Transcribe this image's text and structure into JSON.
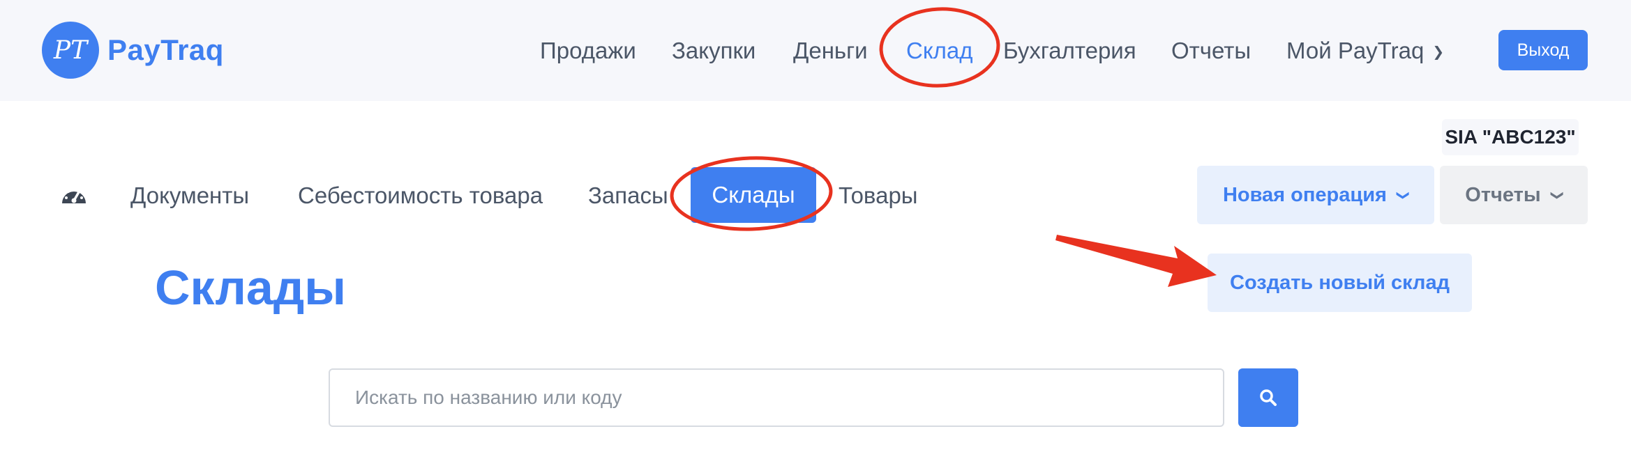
{
  "brand": {
    "logo_monogram": "PT",
    "name": "PayTraq"
  },
  "top_nav": {
    "items": [
      {
        "label": "Продажи"
      },
      {
        "label": "Закупки"
      },
      {
        "label": "Деньги"
      },
      {
        "label": "Склад",
        "active": true
      },
      {
        "label": "Бухгалтерия"
      },
      {
        "label": "Отчеты"
      },
      {
        "label": "Мой PayTraq",
        "has_dropdown": true
      }
    ],
    "logout_label": "Выход"
  },
  "company": "SIA \"ABC123\"",
  "sub_nav": {
    "dashboard_icon": "speedometer-icon",
    "items": [
      {
        "label": "Документы"
      },
      {
        "label": "Себестоимость товара"
      },
      {
        "label": "Запасы"
      },
      {
        "label": "Склады",
        "active": true
      },
      {
        "label": "Товары"
      }
    ],
    "new_operation_label": "Новая операция",
    "reports_label": "Отчеты"
  },
  "page": {
    "title": "Склады",
    "create_button_label": "Создать новый склад",
    "search_placeholder": "Искать по названию или коду",
    "search_value": ""
  },
  "colors": {
    "accent": "#3f7ff0",
    "annotation": "#e8321f"
  }
}
